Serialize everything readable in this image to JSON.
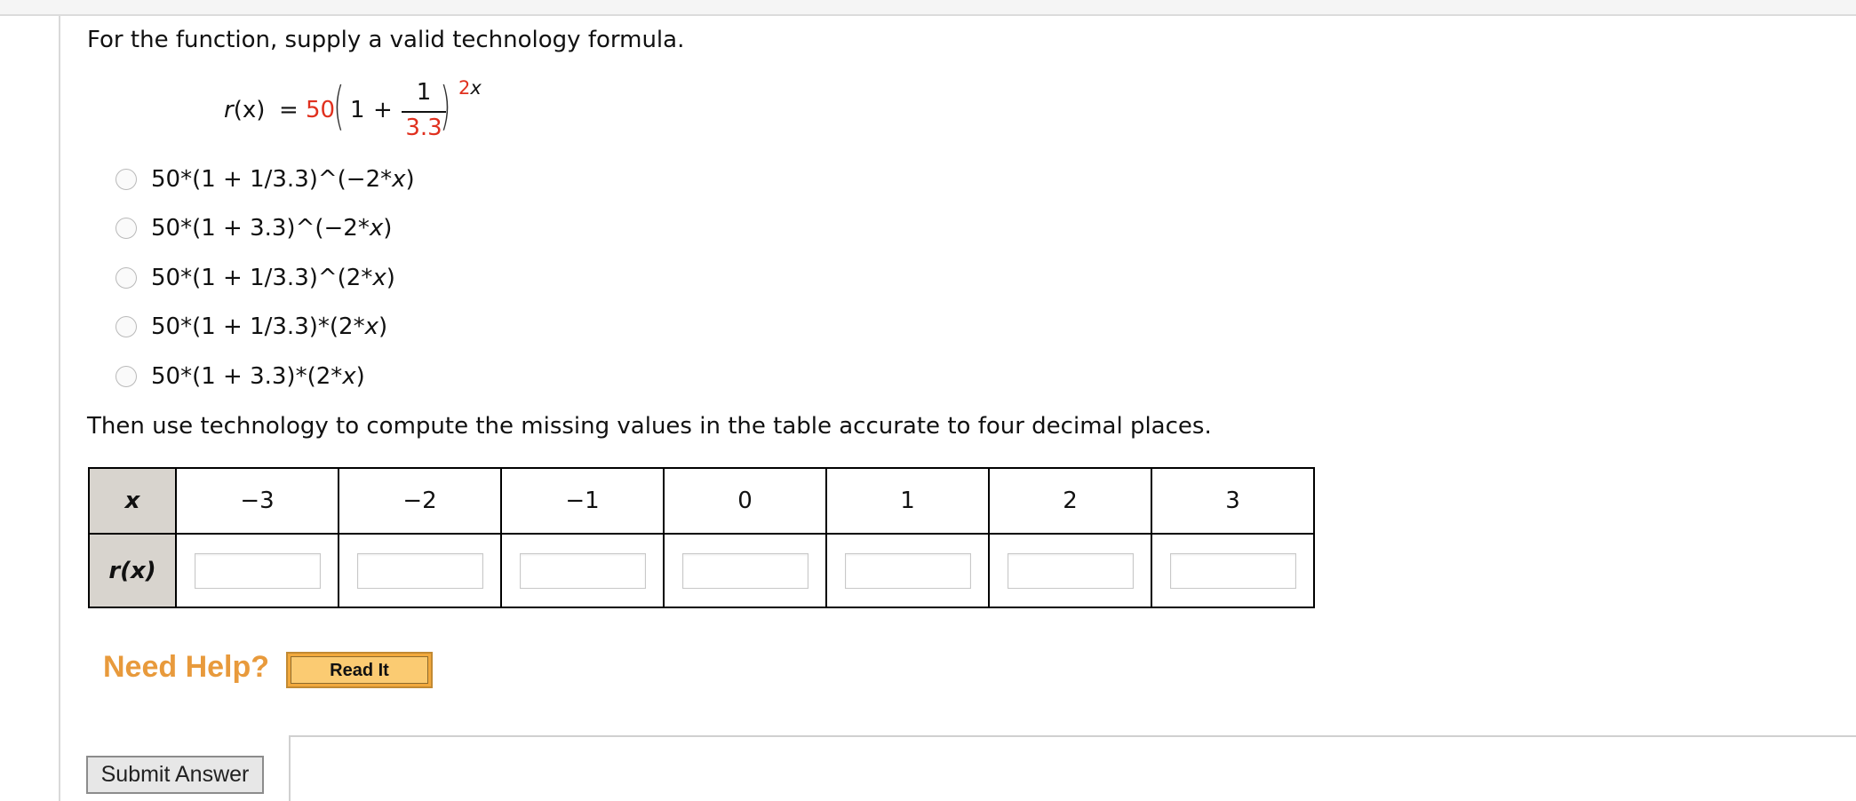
{
  "question": {
    "prompt": "For the function, supply a valid technology formula."
  },
  "formula": {
    "lhs_name": "r",
    "lhs_arg": "(x)",
    "equals": "=",
    "coefficient": "50",
    "one": "1",
    "plus": "+",
    "numerator": "1",
    "denominator": "3.3",
    "exponent_coef": "2",
    "exponent_var": "x"
  },
  "options": [
    {
      "before": "50*(1 + 1/3.3)^(−2*",
      "var": "x",
      "after": ")"
    },
    {
      "before": "50*(1 + 3.3)^(−2*",
      "var": "x",
      "after": ")"
    },
    {
      "before": "50*(1 + 1/3.3)^(2*",
      "var": "x",
      "after": ")"
    },
    {
      "before": "50*(1 + 1/3.3)*(2*",
      "var": "x",
      "after": ")"
    },
    {
      "before": "50*(1 + 3.3)*(2*",
      "var": "x",
      "after": ")"
    }
  ],
  "instruction": "Then use technology to compute the missing values in the table accurate to four decimal places.",
  "table": {
    "x_header": "x",
    "r_header": "r(x)",
    "x_values": [
      "−3",
      "−2",
      "−1",
      "0",
      "1",
      "2",
      "3"
    ],
    "r_values": [
      "",
      "",
      "",
      "",
      "",
      "",
      ""
    ]
  },
  "help": {
    "label": "Need Help?",
    "read_it": "Read It"
  },
  "submit_label": "Submit Answer",
  "colors": {
    "accent_red": "#e0301e",
    "help_orange": "#e89a3c",
    "button_gold": "#f2a93d",
    "header_cell": "#d8d4ce"
  }
}
